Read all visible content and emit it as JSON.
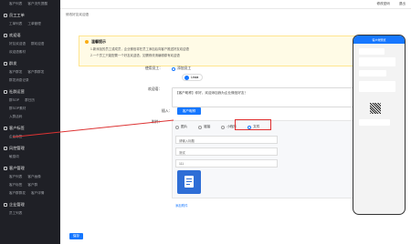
{
  "topbar": {
    "items": [
      "修改密码",
      "退出"
    ]
  },
  "breadcrumb": "修改好友欢迎语",
  "sidebar": {
    "sections": [
      {
        "title": "",
        "rows": [
          [
            "客户列表",
            "客户流失提醒"
          ]
        ]
      },
      {
        "title": "员工工单",
        "rows": [
          [
            "工单列表",
            "工单管理"
          ]
        ]
      },
      {
        "title": "欢迎语",
        "rows": [
          [
            "好友欢迎语",
            "群欢迎语"
          ],
          [
            "欢迎语素材"
          ]
        ]
      },
      {
        "title": "群发",
        "rows": [
          [
            "客户群发",
            "客户群群发"
          ],
          [
            "群发消息记录"
          ]
        ]
      },
      {
        "title": "社群运营",
        "rows": [
          [
            "群SOP",
            "群日历"
          ],
          [
            "群SOP素材"
          ],
          [
            "入群活码"
          ]
        ]
      },
      {
        "title": "客户标签",
        "rows": [
          [
            "企业标签"
          ]
        ]
      },
      {
        "title": "风控管理",
        "rows": [
          [
            "敏感词"
          ]
        ]
      },
      {
        "title": "客户管理",
        "rows": [
          [
            "客户列表",
            "客户画像"
          ],
          [
            "客户标签",
            "客户群"
          ],
          [
            "客户群群发",
            "客户详情"
          ]
        ]
      },
      {
        "title": "企业管理",
        "rows": [
          [
            "员工列表"
          ]
        ]
      }
    ]
  },
  "tip": {
    "title": "温馨提示",
    "lines": [
      "1.新添加的员工或成员，企业微信将在员工添加后向客户推送好友欢迎语",
      "2.一个员工只能配置一个好友欢迎语，如需修改请编辑原有欢迎语"
    ]
  },
  "form": {
    "employee_label": "使用员工：",
    "employee_option": "添加员工",
    "chip_name": "Linda",
    "content_label": "欢迎语：",
    "content_text": "【客户昵称】你好，欢迎添加我为企业微信好友！",
    "insert_label": "插入：",
    "insert_button": "客户昵称",
    "attachment_label": "附件：",
    "tabs": [
      "图片",
      "链接",
      "小程序",
      "文件"
    ],
    "input_placeholder_1": "请输入标题",
    "input_value_2": "测试",
    "input_value_3": "111",
    "add_attachment": "添加附件",
    "submit": "保存"
  },
  "phone": {
    "title": "客户端预览"
  }
}
